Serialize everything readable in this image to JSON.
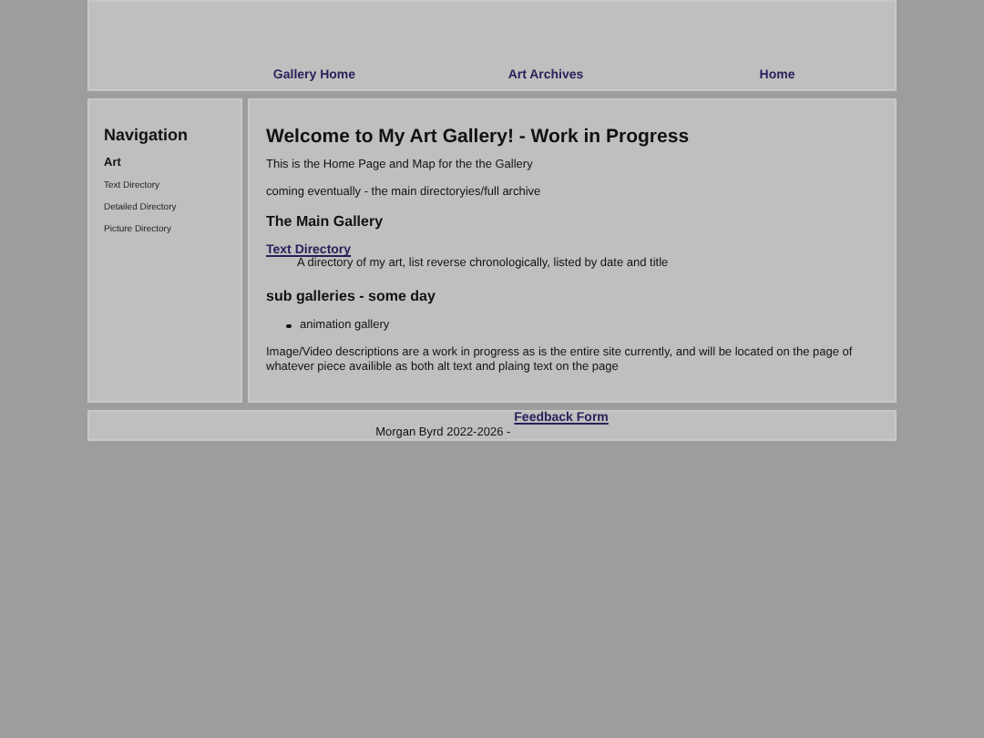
{
  "header": {
    "links": [
      "Gallery Home",
      "Art Archives",
      "Home"
    ]
  },
  "sidebar": {
    "title": "Navigation",
    "section": "Art",
    "items": [
      "Text Directory",
      "Detailed Directory",
      "Picture Directory"
    ]
  },
  "main": {
    "title": "Welcome to My Art Gallery! - Work in Progress",
    "intro": [
      "This is the Home Page and Map for the the Gallery",
      "coming eventually - the main directoryies/full archive"
    ],
    "gallery_heading": "The Main Gallery",
    "directory_link": "Text Directory",
    "directory_description": "A directory of my art, list reverse chronologically, listed by date and title",
    "sub_heading": "sub galleries - some day",
    "sub_items": [
      "animation gallery"
    ],
    "note": "Image/Video descriptions are a work in progress as is the entire site currently, and will be located on the page of whatever piece availible as both alt text and plaing text on the page"
  },
  "footer": {
    "text": "Morgan Byrd 2022-2026 -",
    "link": "Feedback Form"
  }
}
